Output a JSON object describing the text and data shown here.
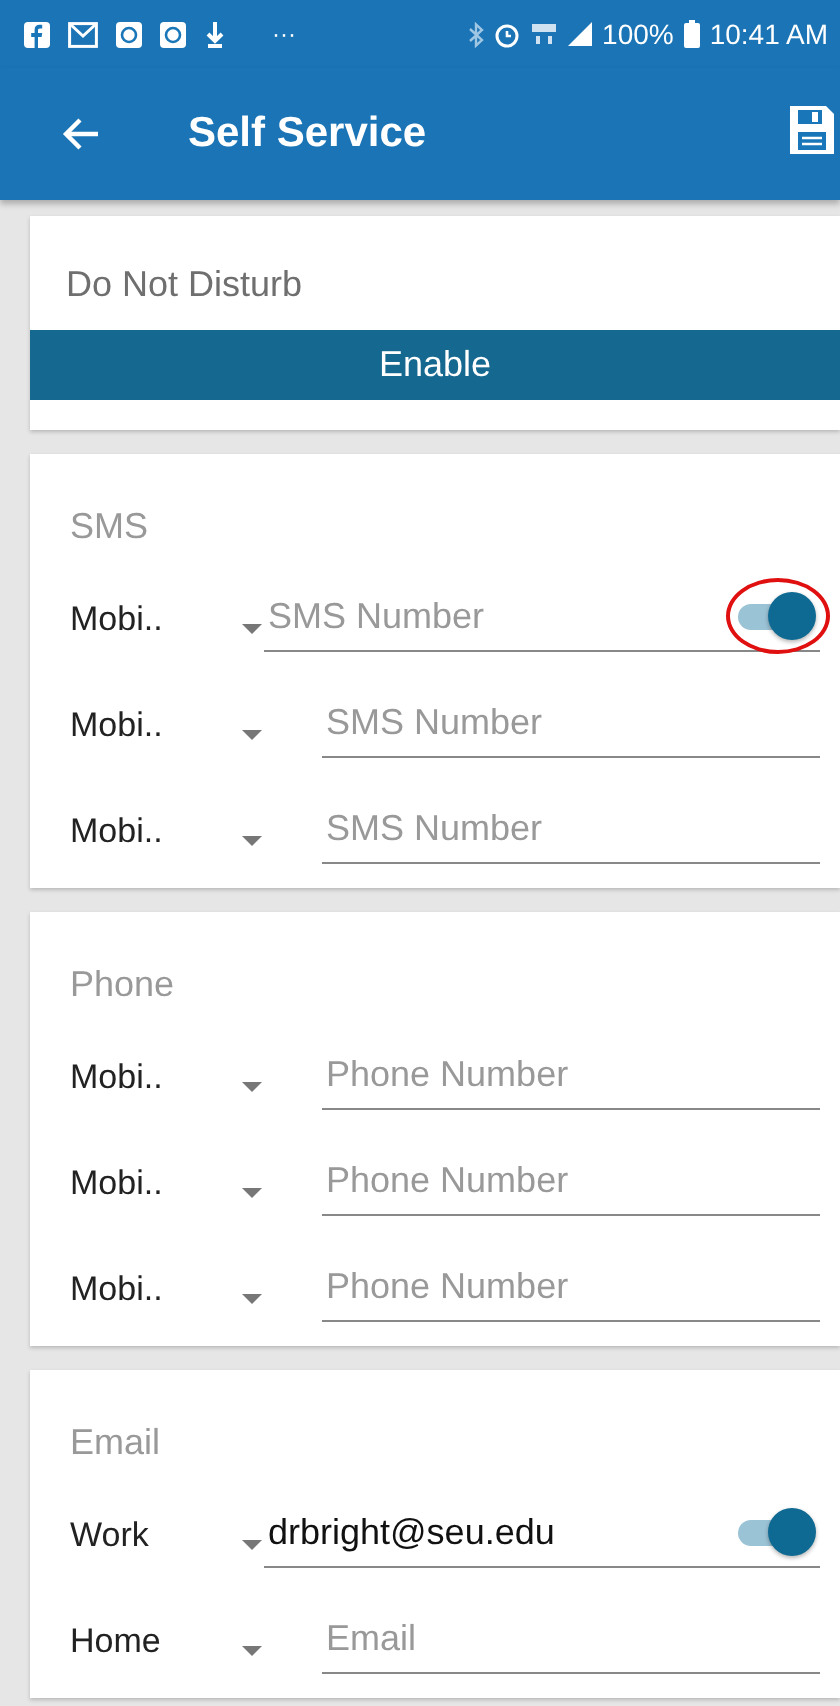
{
  "status_bar": {
    "more": "···",
    "battery": "100%",
    "time": "10:41 AM"
  },
  "app_bar": {
    "title": "Self Service"
  },
  "do_not_disturb": {
    "title": "Do Not Disturb",
    "button": "Enable"
  },
  "sections": [
    {
      "title": "SMS",
      "rows": [
        {
          "type": "Mobi..",
          "value": "",
          "placeholder": "SMS Number",
          "toggle": {
            "on": true,
            "circled": true
          }
        },
        {
          "type": "Mobi..",
          "value": "",
          "placeholder": "SMS Number"
        },
        {
          "type": "Mobi..",
          "value": "",
          "placeholder": "SMS Number"
        }
      ]
    },
    {
      "title": "Phone",
      "rows": [
        {
          "type": "Mobi..",
          "value": "",
          "placeholder": "Phone Number"
        },
        {
          "type": "Mobi..",
          "value": "",
          "placeholder": "Phone Number"
        },
        {
          "type": "Mobi..",
          "value": "",
          "placeholder": "Phone Number"
        }
      ]
    },
    {
      "title": "Email",
      "rows": [
        {
          "type": "Work",
          "value": "drbright@seu.edu",
          "placeholder": "",
          "toggle": {
            "on": true
          }
        },
        {
          "type": "Home",
          "value": "",
          "placeholder": "Email"
        }
      ]
    }
  ]
}
